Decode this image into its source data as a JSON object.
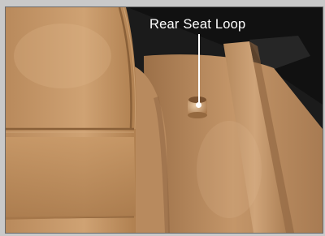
{
  "callout": {
    "label": "Rear Seat Loop"
  },
  "colors": {
    "frame": "#c9c9c9",
    "leather": "#c99a6a",
    "leather_shadow": "#8c6440",
    "interior_dark": "#1b1b1b",
    "belt": "#c2956a",
    "annotation": "#ffffff"
  }
}
